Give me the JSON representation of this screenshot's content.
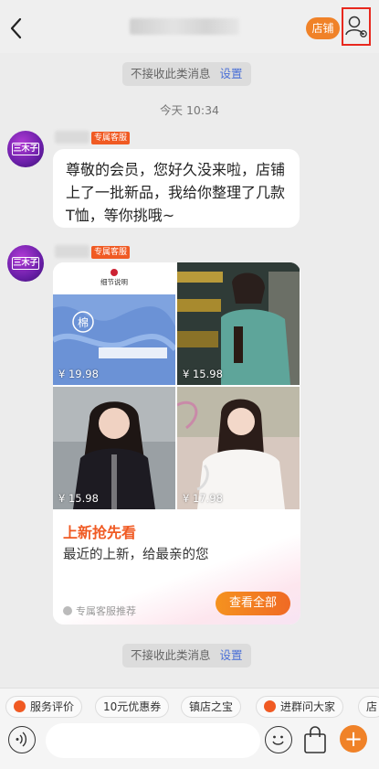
{
  "header": {
    "shop_label": "店铺"
  },
  "notices": {
    "top": {
      "label": "不接收此类消息",
      "action": "设置"
    },
    "bottom": {
      "label": "不接收此类消息",
      "action": "设置"
    }
  },
  "timestamp": "今天 10:34",
  "messages": {
    "badge": "专属客服",
    "avatar_text": "三木子",
    "text_message": "尊敬的会员，您好久没来啦，店铺上了一批新品，我给你整理了几款T恤，等你挑哦~"
  },
  "card": {
    "products": [
      {
        "price": "¥ 19.98",
        "caption": "细节说明",
        "tag": "棉"
      },
      {
        "price": "¥ 15.98"
      },
      {
        "price": "¥ 15.98"
      },
      {
        "price": "¥ 17.98"
      }
    ],
    "title": "上新抢先看",
    "subtitle": "最近的上新，给最亲的您",
    "footer": "专属客服推荐",
    "button": "查看全部"
  },
  "quick_actions": [
    "服务评价",
    "10元优惠券",
    "镇店之宝",
    "进群问大家",
    "店"
  ],
  "input": {
    "placeholder": ""
  },
  "colors": {
    "accent": "#f08228",
    "badge": "#f05a23",
    "link": "#4a6fd6",
    "highlight_border": "#e8281e"
  },
  "icons": [
    "back-icon",
    "profile-settings-icon",
    "voice-icon",
    "emoji-icon",
    "bag-icon",
    "plus-icon"
  ]
}
